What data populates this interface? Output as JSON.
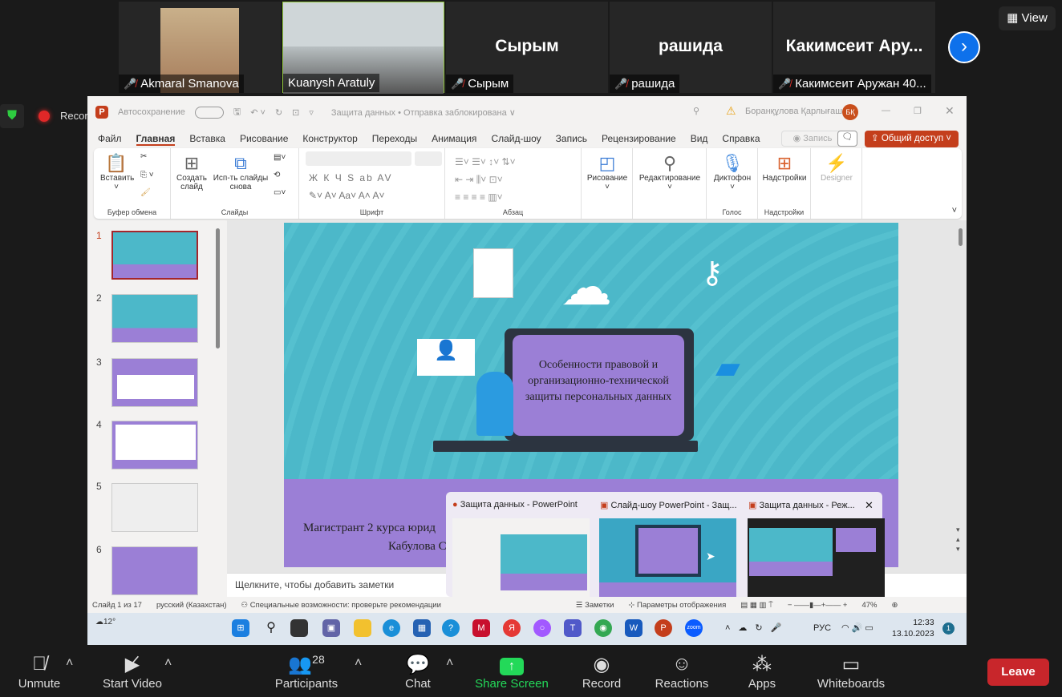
{
  "zoom": {
    "participants_tiles": [
      {
        "name": "Akmaral Smanova",
        "big": "",
        "muted": true
      },
      {
        "name": "Kuanysh Aratuly",
        "big": "",
        "muted": false
      },
      {
        "name": "Сырым",
        "big": "Сырым",
        "muted": true
      },
      {
        "name": "рашида",
        "big": "рашида",
        "muted": true
      },
      {
        "name": "Какимсеит Аружан 40...",
        "big": "Какимсеит  Ару...",
        "muted": true
      }
    ],
    "view_label": "View",
    "recording_label": "Recording",
    "toolbar": {
      "unmute": "Unmute",
      "start_video": "Start Video",
      "participants": "Participants",
      "participants_count": "28",
      "chat": "Chat",
      "share_screen": "Share Screen",
      "record": "Record",
      "reactions": "Reactions",
      "apps": "Apps",
      "whiteboards": "Whiteboards",
      "leave": "Leave"
    }
  },
  "ppt": {
    "autosave": "Автосохранение",
    "doc_title": "Защита данных • Отправка заблокирована ∨",
    "user": "Боранқұлова Қарлығаш",
    "user_initials": "БҚ",
    "tabs": [
      "Файл",
      "Главная",
      "Вставка",
      "Рисование",
      "Конструктор",
      "Переходы",
      "Анимация",
      "Слайд-шоу",
      "Запись",
      "Рецензирование",
      "Вид",
      "Справка"
    ],
    "record_btn": "Запись",
    "share_btn": "Общий доступ",
    "ribbon": {
      "paste": "Вставить",
      "clipboard": "Буфер обмена",
      "new_slide": "Создать слайд",
      "reuse": "Исп-ть слайды снова",
      "slides": "Слайды",
      "font": "Шрифт",
      "paragraph": "Абзац",
      "drawing": "Рисование",
      "editing": "Редактирование",
      "dictate": "Диктофон",
      "voice": "Голос",
      "addins": "Надстройки",
      "addins_group": "Надстройки",
      "designer": "Designer",
      "font_btns": "Ж  К  Ч  S  ab  AV"
    },
    "slide_numbers": [
      "1",
      "2",
      "3",
      "4",
      "5",
      "6"
    ],
    "slide": {
      "screen_text": "Особенности правовой и организационно-технической защиты персональных данных",
      "bottom_line1": "Магистрант 2 курса юрид",
      "bottom_line2": "Кабулова С"
    },
    "notes_placeholder": "Щелкните, чтобы добавить заметки",
    "status": {
      "slide": "Слайд 1 из 17",
      "lang": "русский (Казахстан)",
      "access": "Специальные возможности: проверьте рекомендации",
      "notes": "Заметки",
      "display": "Параметры отображения",
      "zoom": "47%"
    },
    "colors": {
      "slide_teal": "#4cb8c9",
      "slide_purple": "#9b7fd6",
      "accent": "#c43e1c"
    }
  },
  "taskbar": {
    "weather": "12°",
    "lang": "РУС",
    "time": "12:33",
    "date": "13.10.2023",
    "notif": "1",
    "preview": [
      {
        "title": "Защита данных - PowerPoint"
      },
      {
        "title": "Слайд-шоу PowerPoint  - Защ..."
      },
      {
        "title": "Защита данных - Реж..."
      }
    ]
  }
}
